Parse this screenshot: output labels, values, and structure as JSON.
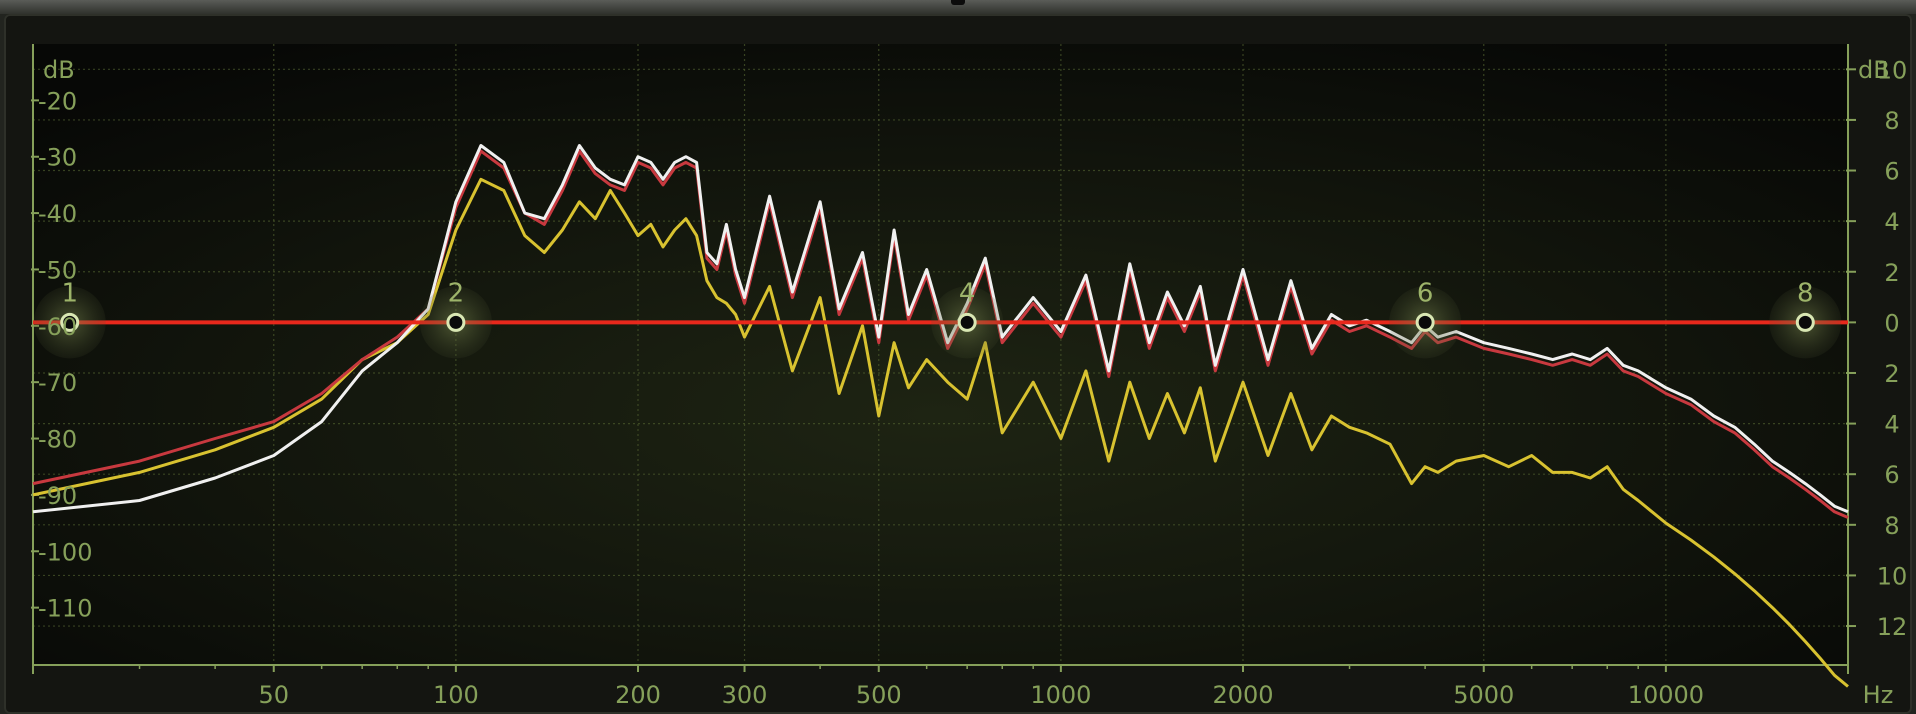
{
  "panel": {
    "unit_left": "dB",
    "unit_right": "dB",
    "unit_freq": "Hz"
  },
  "colors": {
    "background": "#0c0d0a",
    "grid": "#4b5a2c",
    "label": "#86a05a",
    "zero_line": "#e8281c",
    "node_fill": "#0a0a0a",
    "node_ring": "#d9e7b3"
  },
  "chart_data": {
    "type": "line",
    "title": "",
    "xlabel": "Hz",
    "ylabel_left": "dB",
    "ylabel_right": "dB",
    "x_scale": "log",
    "xlim": [
      20,
      20000
    ],
    "ylim_left": [
      -120,
      -10
    ],
    "ylim_right": [
      -13.5,
      11
    ],
    "grid": true,
    "x_ticks": [
      50,
      100,
      200,
      300,
      500,
      1000,
      2000,
      5000,
      10000
    ],
    "x_tick_labels": [
      "50",
      "100",
      "200",
      "300",
      "500",
      "1000",
      "2000",
      "5000",
      "10000"
    ],
    "left_ticks": [
      -20,
      -30,
      -40,
      -50,
      -60,
      -70,
      -80,
      -90,
      -100,
      -110
    ],
    "left_tick_labels": [
      "-20",
      "-30",
      "-40",
      "-50",
      "-60",
      "-70",
      "-80",
      "-90",
      "-100",
      "-110"
    ],
    "right_ticks": [
      10,
      8,
      6,
      4,
      2,
      0,
      -2,
      -4,
      -6,
      -8,
      -10,
      -12
    ],
    "right_tick_labels": [
      "10",
      "8",
      "6",
      "4",
      "2",
      "0",
      "2",
      "4",
      "6",
      "8",
      "10",
      "12"
    ],
    "eq_curve_gain_db": 0,
    "band_nodes": [
      {
        "label": "1",
        "freq": 23,
        "gain": 0
      },
      {
        "label": "2",
        "freq": 100,
        "gain": 0
      },
      {
        "label": "4",
        "freq": 700,
        "gain": 0
      },
      {
        "label": "6",
        "freq": 4000,
        "gain": 0
      },
      {
        "label": "8",
        "freq": 17000,
        "gain": 0
      }
    ],
    "series": [
      {
        "color": "#f0f0f0",
        "x": [
          20,
          30,
          40,
          50,
          60,
          70,
          80,
          90,
          100,
          110,
          120,
          130,
          140,
          150,
          160,
          170,
          180,
          190,
          200,
          210,
          220,
          230,
          240,
          250,
          260,
          270,
          280,
          290,
          300,
          330,
          360,
          400,
          430,
          470,
          500,
          530,
          560,
          600,
          650,
          700,
          750,
          800,
          900,
          1000,
          1100,
          1200,
          1300,
          1400,
          1500,
          1600,
          1700,
          1800,
          2000,
          2200,
          2400,
          2600,
          2800,
          3000,
          3200,
          3500,
          3800,
          4000,
          4200,
          4500,
          5000,
          5500,
          6000,
          6500,
          7000,
          7500,
          8000,
          8500,
          9000,
          10000,
          11000,
          12000,
          13000,
          14000,
          15000,
          16000,
          17000,
          18000,
          19000,
          20000
        ],
        "values": [
          -93,
          -91,
          -87,
          -83,
          -77,
          -68,
          -63,
          -57,
          -38,
          -28,
          -31,
          -40,
          -41,
          -35,
          -28,
          -32,
          -34,
          -35,
          -30,
          -31,
          -34,
          -31,
          -30,
          -31,
          -47,
          -49,
          -42,
          -50,
          -55,
          -37,
          -54,
          -38,
          -57,
          -47,
          -62,
          -43,
          -58,
          -50,
          -63,
          -56,
          -48,
          -62,
          -55,
          -61,
          -51,
          -68,
          -49,
          -63,
          -54,
          -60,
          -53,
          -67,
          -50,
          -66,
          -52,
          -64,
          -58,
          -60,
          -59,
          -61,
          -63,
          -60,
          -62,
          -61,
          -63,
          -64,
          -65,
          -66,
          -65,
          -66,
          -64,
          -67,
          -68,
          -71,
          -73,
          -76,
          -78,
          -81,
          -84,
          -86,
          -88,
          -90,
          -92,
          -93
        ]
      },
      {
        "color": "#c8393f",
        "x": [
          20,
          30,
          40,
          50,
          60,
          70,
          80,
          90,
          100,
          110,
          120,
          130,
          140,
          150,
          160,
          170,
          180,
          190,
          200,
          210,
          220,
          230,
          240,
          250,
          260,
          270,
          280,
          290,
          300,
          330,
          360,
          400,
          430,
          470,
          500,
          530,
          560,
          600,
          650,
          700,
          750,
          800,
          900,
          1000,
          1100,
          1200,
          1300,
          1400,
          1500,
          1600,
          1700,
          1800,
          2000,
          2200,
          2400,
          2600,
          2800,
          3000,
          3200,
          3500,
          3800,
          4000,
          4200,
          4500,
          5000,
          5500,
          6000,
          6500,
          7000,
          7500,
          8000,
          8500,
          9000,
          10000,
          11000,
          12000,
          13000,
          14000,
          15000,
          16000,
          17000,
          18000,
          19000,
          20000
        ],
        "values": [
          -88,
          -84,
          -80,
          -77,
          -72,
          -66,
          -62,
          -57,
          -39,
          -29,
          -32,
          -40,
          -42,
          -36,
          -29,
          -33,
          -35,
          -36,
          -31,
          -32,
          -35,
          -32,
          -31,
          -32,
          -48,
          -50,
          -43,
          -51,
          -56,
          -38,
          -55,
          -39,
          -58,
          -48,
          -63,
          -44,
          -59,
          -51,
          -64,
          -57,
          -49,
          -63,
          -56,
          -62,
          -52,
          -69,
          -50,
          -64,
          -55,
          -61,
          -54,
          -68,
          -51,
          -67,
          -53,
          -65,
          -59,
          -61,
          -60,
          -62,
          -64,
          -61,
          -63,
          -62,
          -64,
          -65,
          -66,
          -67,
          -66,
          -67,
          -65,
          -68,
          -69,
          -72,
          -74,
          -77,
          -79,
          -82,
          -85,
          -87,
          -89,
          -91,
          -93,
          -94
        ]
      },
      {
        "color": "#d8c230",
        "x": [
          20,
          30,
          40,
          50,
          60,
          70,
          80,
          90,
          100,
          110,
          120,
          130,
          140,
          150,
          160,
          170,
          180,
          190,
          200,
          210,
          220,
          230,
          240,
          250,
          260,
          270,
          280,
          290,
          300,
          330,
          360,
          400,
          430,
          470,
          500,
          530,
          560,
          600,
          650,
          700,
          750,
          800,
          900,
          1000,
          1100,
          1200,
          1300,
          1400,
          1500,
          1600,
          1700,
          1800,
          2000,
          2200,
          2400,
          2600,
          2800,
          3000,
          3200,
          3500,
          3800,
          4000,
          4200,
          4500,
          5000,
          5500,
          6000,
          6500,
          7000,
          7500,
          8000,
          8500,
          9000,
          10000,
          11000,
          12000,
          13000,
          14000,
          15000,
          16000,
          17000,
          18000,
          19000,
          20000
        ],
        "values": [
          -90,
          -86,
          -82,
          -78,
          -73,
          -66,
          -63,
          -58,
          -43,
          -34,
          -36,
          -44,
          -47,
          -43,
          -38,
          -41,
          -36,
          -40,
          -44,
          -42,
          -46,
          -43,
          -41,
          -44,
          -52,
          -55,
          -56,
          -58,
          -62,
          -53,
          -68,
          -55,
          -72,
          -60,
          -76,
          -63,
          -71,
          -66,
          -70,
          -73,
          -63,
          -79,
          -70,
          -80,
          -68,
          -84,
          -70,
          -80,
          -72,
          -79,
          -71,
          -84,
          -70,
          -83,
          -72,
          -82,
          -76,
          -78,
          -79,
          -81,
          -88,
          -85,
          -86,
          -84,
          -83,
          -85,
          -83,
          -86,
          -86,
          -87,
          -85,
          -89,
          -91,
          -95,
          -98,
          -101,
          -104,
          -107,
          -110,
          -113,
          -116,
          -119,
          -122,
          -124
        ]
      }
    ]
  }
}
